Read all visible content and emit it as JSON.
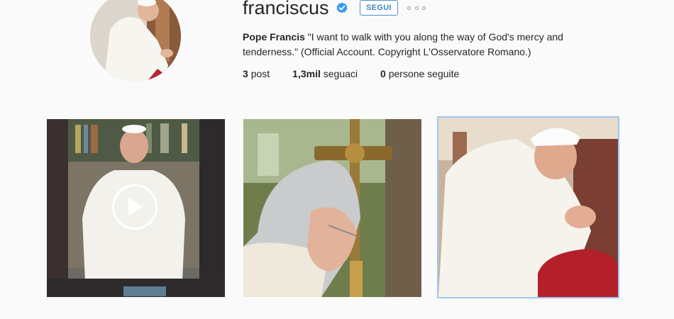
{
  "profile": {
    "username": "franciscus",
    "verified_icon": "verified-badge-icon",
    "follow_label": "SEGUI",
    "more_icon": "more-options-icon",
    "bio_name": "Pope Francis",
    "bio_text": " \"I want to walk with you along the way of God's mercy and tenderness.\" (Official Account. Copyright L'Osservatore Romano.)",
    "stats": [
      {
        "value": "3",
        "label": "post"
      },
      {
        "value": "1,3mil",
        "label": "seguaci"
      },
      {
        "value": "0",
        "label": "persone seguite"
      }
    ]
  },
  "posts": [
    {
      "type": "video",
      "icon": "play-icon"
    },
    {
      "type": "image"
    },
    {
      "type": "image"
    }
  ],
  "colors": {
    "accent": "#3f83c8",
    "background": "#fafafa",
    "text": "#262626"
  }
}
